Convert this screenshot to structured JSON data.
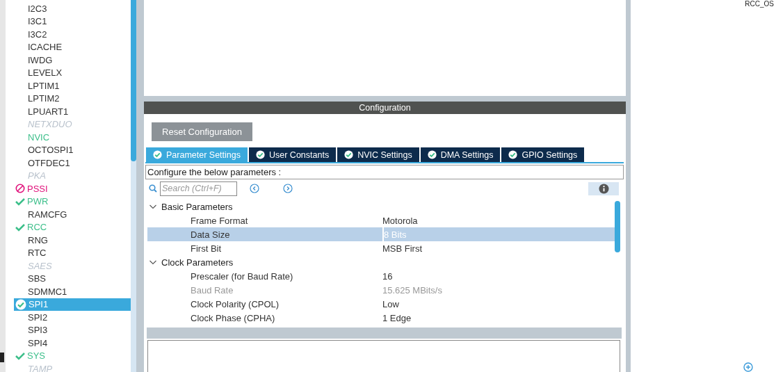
{
  "sidebar": {
    "items": [
      {
        "label": "I2C3",
        "kind": "plain",
        "selected": false
      },
      {
        "label": "I3C1",
        "kind": "plain",
        "selected": false
      },
      {
        "label": "I3C2",
        "kind": "plain",
        "selected": false
      },
      {
        "label": "ICACHE",
        "kind": "plain",
        "selected": false
      },
      {
        "label": "IWDG",
        "kind": "plain",
        "selected": false
      },
      {
        "label": "LEVELX",
        "kind": "plain",
        "selected": false
      },
      {
        "label": "LPTIM1",
        "kind": "plain",
        "selected": false
      },
      {
        "label": "LPTIM2",
        "kind": "plain",
        "selected": false
      },
      {
        "label": "LPUART1",
        "kind": "plain",
        "selected": false
      },
      {
        "label": "NETXDUO",
        "kind": "unavailable",
        "selected": false
      },
      {
        "label": "NVIC",
        "kind": "enabled",
        "selected": false
      },
      {
        "label": "OCTOSPI1",
        "kind": "plain",
        "selected": false
      },
      {
        "label": "OTFDEC1",
        "kind": "plain",
        "selected": false
      },
      {
        "label": "PKA",
        "kind": "unavailable",
        "selected": false
      },
      {
        "label": "PSSI",
        "kind": "conflict",
        "selected": false
      },
      {
        "label": "PWR",
        "kind": "configured",
        "selected": false
      },
      {
        "label": "RAMCFG",
        "kind": "plain",
        "selected": false
      },
      {
        "label": "RCC",
        "kind": "configured",
        "selected": false
      },
      {
        "label": "RNG",
        "kind": "plain",
        "selected": false
      },
      {
        "label": "RTC",
        "kind": "plain",
        "selected": false
      },
      {
        "label": "SAES",
        "kind": "unavailable",
        "selected": false
      },
      {
        "label": "SBS",
        "kind": "plain",
        "selected": false
      },
      {
        "label": "SDMMC1",
        "kind": "plain",
        "selected": false
      },
      {
        "label": "SPI1",
        "kind": "configured",
        "selected": true
      },
      {
        "label": "SPI2",
        "kind": "plain",
        "selected": false
      },
      {
        "label": "SPI3",
        "kind": "plain",
        "selected": false
      },
      {
        "label": "SPI4",
        "kind": "plain",
        "selected": false
      },
      {
        "label": "SYS",
        "kind": "configured",
        "selected": false
      },
      {
        "label": "TAMP",
        "kind": "unavailable",
        "selected": false
      }
    ]
  },
  "configuration": {
    "title": "Configuration",
    "reset_button": "Reset Configuration",
    "tabs": [
      {
        "label": "Parameter Settings",
        "selected": true
      },
      {
        "label": "User Constants",
        "selected": false
      },
      {
        "label": "NVIC Settings",
        "selected": false
      },
      {
        "label": "DMA Settings",
        "selected": false
      },
      {
        "label": "GPIO Settings",
        "selected": false
      }
    ],
    "description": "Configure the below parameters :",
    "search": {
      "placeholder": "Search (Ctrl+F)"
    },
    "groups": [
      {
        "label": "Basic Parameters",
        "expanded": true,
        "rows": [
          {
            "name": "Frame Format",
            "value": "Motorola",
            "selected": false,
            "disabled": false
          },
          {
            "name": "Data Size",
            "value": "8 Bits",
            "selected": true,
            "disabled": false
          },
          {
            "name": "First Bit",
            "value": "MSB First",
            "selected": false,
            "disabled": false
          }
        ]
      },
      {
        "label": "Clock Parameters",
        "expanded": true,
        "rows": [
          {
            "name": "Prescaler (for Baud Rate)",
            "value": "16",
            "selected": false,
            "disabled": false
          },
          {
            "name": "Baud Rate",
            "value": "15.625 MBits/s",
            "selected": false,
            "disabled": true
          },
          {
            "name": "Clock Polarity (CPOL)",
            "value": "Low",
            "selected": false,
            "disabled": false
          },
          {
            "name": "Clock Phase (CPHA)",
            "value": "1 Edge",
            "selected": false,
            "disabled": false
          }
        ]
      }
    ]
  },
  "right_panel": {
    "label": "RCC_OS"
  }
}
